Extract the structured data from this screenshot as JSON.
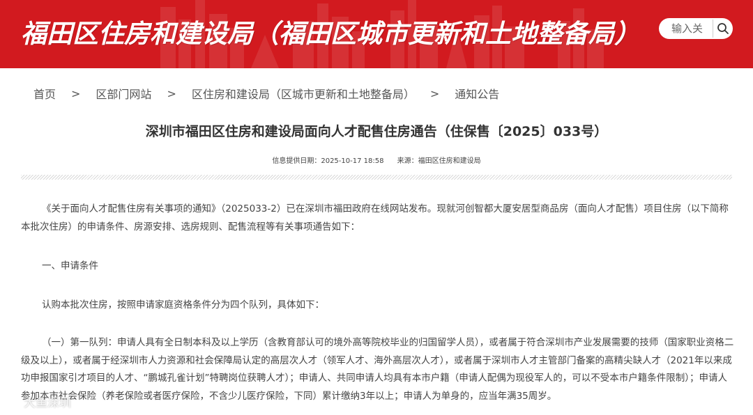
{
  "header": {
    "site_title": "福田区住房和建设局（福田区城市更新和土地整备局）",
    "brand_color": "#d21a1f",
    "search": {
      "placeholder": "输入关",
      "button_icon": "search-icon"
    }
  },
  "breadcrumb": {
    "items": [
      "首页",
      "区部门网站",
      "区住房和建设局（区城市更新和土地整备局）",
      "通知公告"
    ],
    "separator": ">"
  },
  "article": {
    "title": "深圳市福田区住房和建设局面向人才配售住房通告（住保售〔2025〕033号）",
    "meta_date": "信息提供日期：2025-10-17 18:58",
    "meta_source": "来源：福田区住房和建设局",
    "paragraphs": [
      "《关于面向人才配售住房有关事项的通知》（2025033-2）已在深圳市福田政府在线网站发布。现就河创智都大厦安居型商品房（面向人才配售）项目住房（以下简称本批次住房）的申请条件、房源安排、选房规则、配售流程等有关事项通告如下：",
      "一、申请条件",
      "认购本批次住房，按照申请家庭资格条件分为四个队列，具体如下：",
      "（一）第一队列：申请人具有全日制本科及以上学历（含教育部认可的境外高等院校毕业的归国留学人员），或者属于符合深圳市产业发展需要的技师（国家职业资格二级及以上），或者属于经深圳市人力资源和社会保障局认定的高层次人才（领军人才、海外高层次人才），或者属于深圳市人才主管部门备案的高精尖缺人才（2021年以来成功申报国家引才项目的人才、“鹏城孔雀计划”特聘岗位获聘人才）；申请人、共同申请人均具有本市户籍（申请人配偶为现役军人的，可以不受本市户籍条件限制）；申请人参加本市社会保险（养老保险或者医疗保险，不含少儿医疗保险，下同）累计缴纳3年以上；申请人为单身的，应当年满35周岁。"
    ]
  },
  "watermark": {
    "text": "大鱼深圳",
    "icon": "fish-logo-icon"
  }
}
